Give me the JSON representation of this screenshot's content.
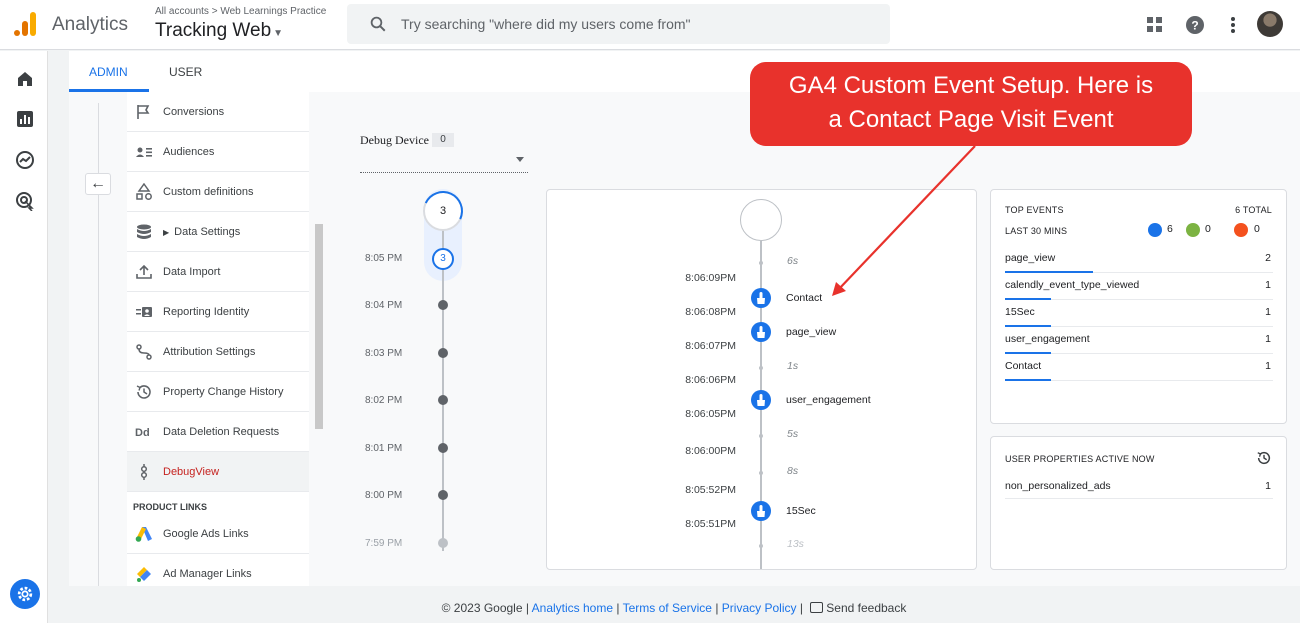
{
  "header": {
    "app_name": "Analytics",
    "breadcrumb": "All accounts > Web Learnings Practice",
    "property": "Tracking Web",
    "search_placeholder": "Try searching \"where did my users come from\""
  },
  "tabs": [
    {
      "label": "ADMIN",
      "active": true
    },
    {
      "label": "USER",
      "active": false
    }
  ],
  "nav": {
    "items": [
      {
        "label": "Conversions",
        "icon": "flag-icon"
      },
      {
        "label": "Audiences",
        "icon": "audience-icon"
      },
      {
        "label": "Custom definitions",
        "icon": "shapes-icon"
      },
      {
        "label": "Data Settings",
        "icon": "database-icon"
      },
      {
        "label": "Data Import",
        "icon": "upload-icon"
      },
      {
        "label": "Reporting Identity",
        "icon": "identity-icon"
      },
      {
        "label": "Attribution Settings",
        "icon": "attribution-icon"
      },
      {
        "label": "Property Change History",
        "icon": "history-icon"
      },
      {
        "label": "Data Deletion Requests",
        "icon": "dd-icon"
      },
      {
        "label": "DebugView",
        "icon": "debug-icon",
        "active": true
      }
    ],
    "section_label": "PRODUCT LINKS",
    "links": [
      {
        "label": "Google Ads Links",
        "icon": "google-ads-icon"
      },
      {
        "label": "Ad Manager Links",
        "icon": "ad-manager-icon"
      }
    ]
  },
  "debug": {
    "label": "Debug Device",
    "count": "0",
    "minute_top_count": "3",
    "minute_selected_count": "3",
    "minutes": [
      "8:05 PM",
      "8:04 PM",
      "8:03 PM",
      "8:02 PM",
      "8:01 PM",
      "8:00 PM",
      "7:59 PM"
    ]
  },
  "stream": {
    "times": [
      "8:06:09PM",
      "8:06:08PM",
      "8:06:07PM",
      "8:06:06PM",
      "8:06:05PM",
      "8:06:00PM",
      "8:05:52PM",
      "8:05:51PM"
    ],
    "gaps": [
      "6s",
      "1s",
      "5s",
      "8s",
      "13s"
    ],
    "events": [
      "Contact",
      "page_view",
      "user_engagement",
      "15Sec"
    ]
  },
  "top_events": {
    "title": "TOP EVENTS",
    "total": "6 TOTAL",
    "subtitle": "LAST 30 MINS",
    "counts": {
      "events": "6",
      "conversions": "0",
      "errors": "0"
    },
    "rows": [
      {
        "name": "page_view",
        "value": "2",
        "share": 0.33
      },
      {
        "name": "calendly_event_type_viewed",
        "value": "1",
        "share": 0.17
      },
      {
        "name": "15Sec",
        "value": "1",
        "share": 0.17
      },
      {
        "name": "user_engagement",
        "value": "1",
        "share": 0.17
      },
      {
        "name": "Contact",
        "value": "1",
        "share": 0.17
      }
    ]
  },
  "user_properties": {
    "title": "USER PROPERTIES ACTIVE NOW",
    "rows": [
      {
        "name": "non_personalized_ads",
        "value": "1"
      }
    ]
  },
  "footer": {
    "copyright": "© 2023 Google |",
    "analytics_home": "Analytics home",
    "terms": "Terms of Service",
    "privacy": "Privacy Policy",
    "feedback": "Send feedback"
  },
  "callout": {
    "line1": "GA4 Custom Event Setup. Here is",
    "line2": "a Contact Page Visit Event"
  },
  "colors": {
    "accent": "#1a73e8",
    "callout": "#e8322c",
    "active_nav": "#c5221f"
  }
}
